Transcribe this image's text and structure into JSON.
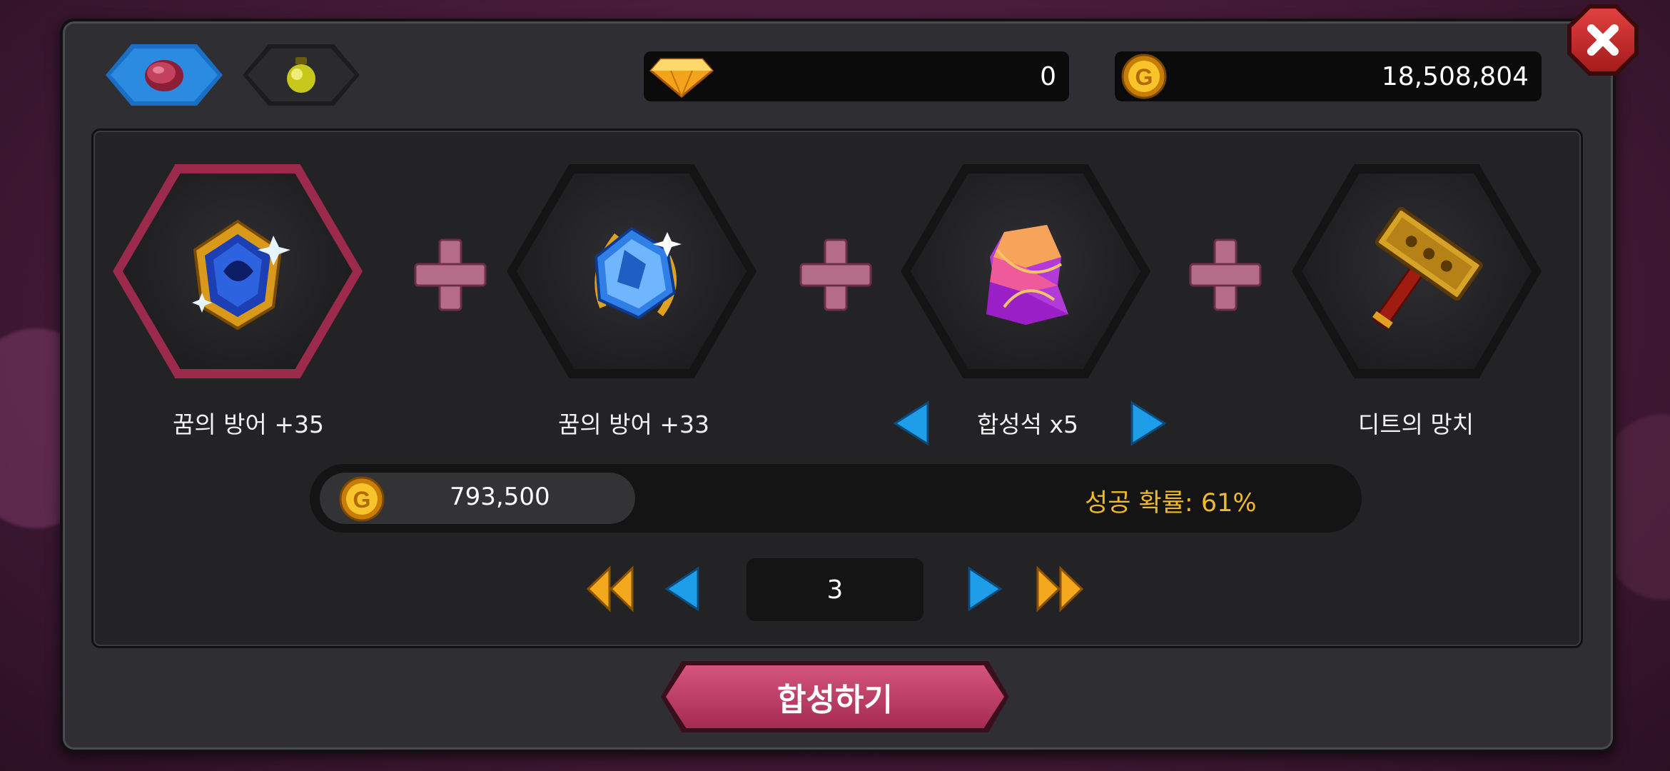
{
  "tabs": [
    {
      "icon": "red-gem-icon",
      "active": true
    },
    {
      "icon": "yellow-orb-icon",
      "active": false
    }
  ],
  "currency": {
    "diamonds": "0",
    "gold": "18,508,804"
  },
  "items": [
    {
      "label": "꿈의 방어 +35",
      "icon": "blue-armor-gem-icon",
      "selected": true
    },
    {
      "label": "꿈의 방어 +33",
      "icon": "blue-gem-icon",
      "selected": false
    },
    {
      "label": "합성석 x5",
      "icon": "synthesis-stone-icon",
      "selected": false
    },
    {
      "label": "디트의 망치",
      "icon": "hammer-icon",
      "selected": false
    }
  ],
  "cost": {
    "amount": "793,500",
    "success_rate": "성공 확률: 61%"
  },
  "pager": {
    "page": "3"
  },
  "synth_button": {
    "label": "합성하기"
  },
  "colors": {
    "accent_pink": "#a42b52",
    "success_gold": "#f0b928",
    "arrow_blue": "#1e9ee8",
    "arrow_gold": "#f4a81c"
  }
}
